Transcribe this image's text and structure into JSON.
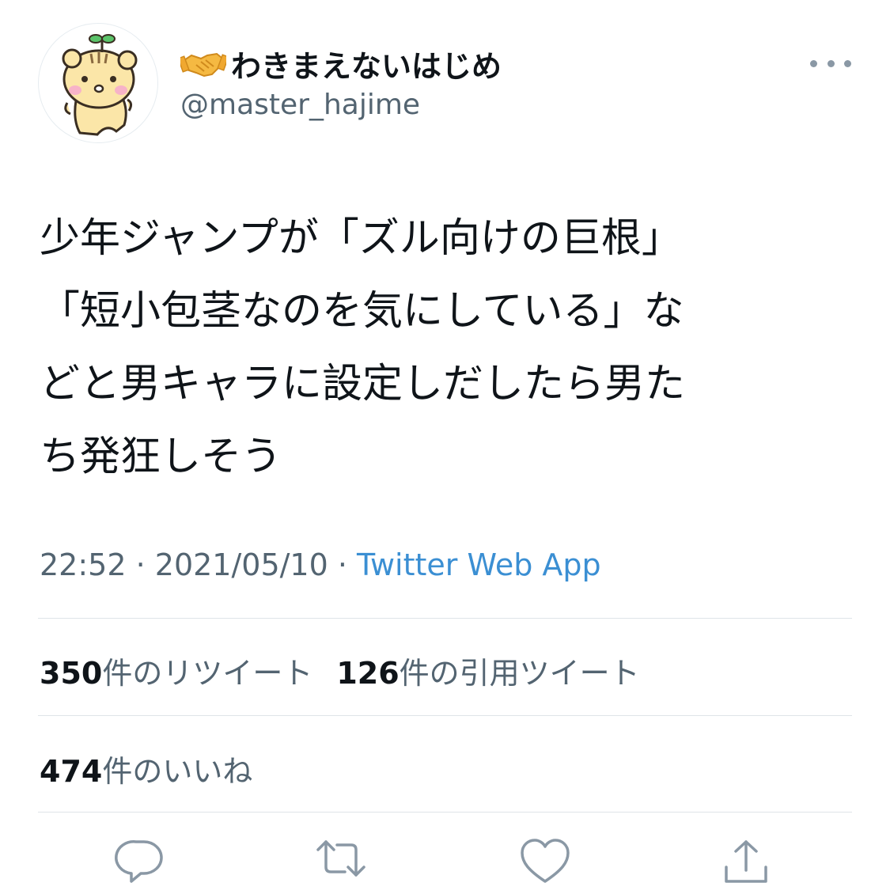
{
  "user": {
    "display_name": "わきまえないはじめ",
    "handle": "@master_hajime",
    "name_emoji": "handshake-icon",
    "avatar": "hamster-avatar"
  },
  "tweet": {
    "text": "少年ジャンプが「ズル向けの巨根」\n「短小包茎なのを気にしている」な\nどと男キャラに設定しだしたら男た\nち発狂しそう",
    "time": "22:52",
    "date": "2021/05/10",
    "separator": " · ",
    "source": "Twitter Web App"
  },
  "stats": {
    "retweets_count": "350",
    "retweets_label": "件のリツイート",
    "quotes_count": "126",
    "quotes_label": "件の引用ツイート",
    "likes_count": "474",
    "likes_label": "件のいいね"
  },
  "actions": {
    "reply": "reply-icon",
    "retweet": "retweet-icon",
    "like": "heart-icon",
    "share": "share-icon"
  },
  "colors": {
    "text": "#0f1419",
    "secondary": "#536471",
    "link": "#3b8fd3",
    "icon": "#8a98a5",
    "divider": "#dfe4e8"
  }
}
